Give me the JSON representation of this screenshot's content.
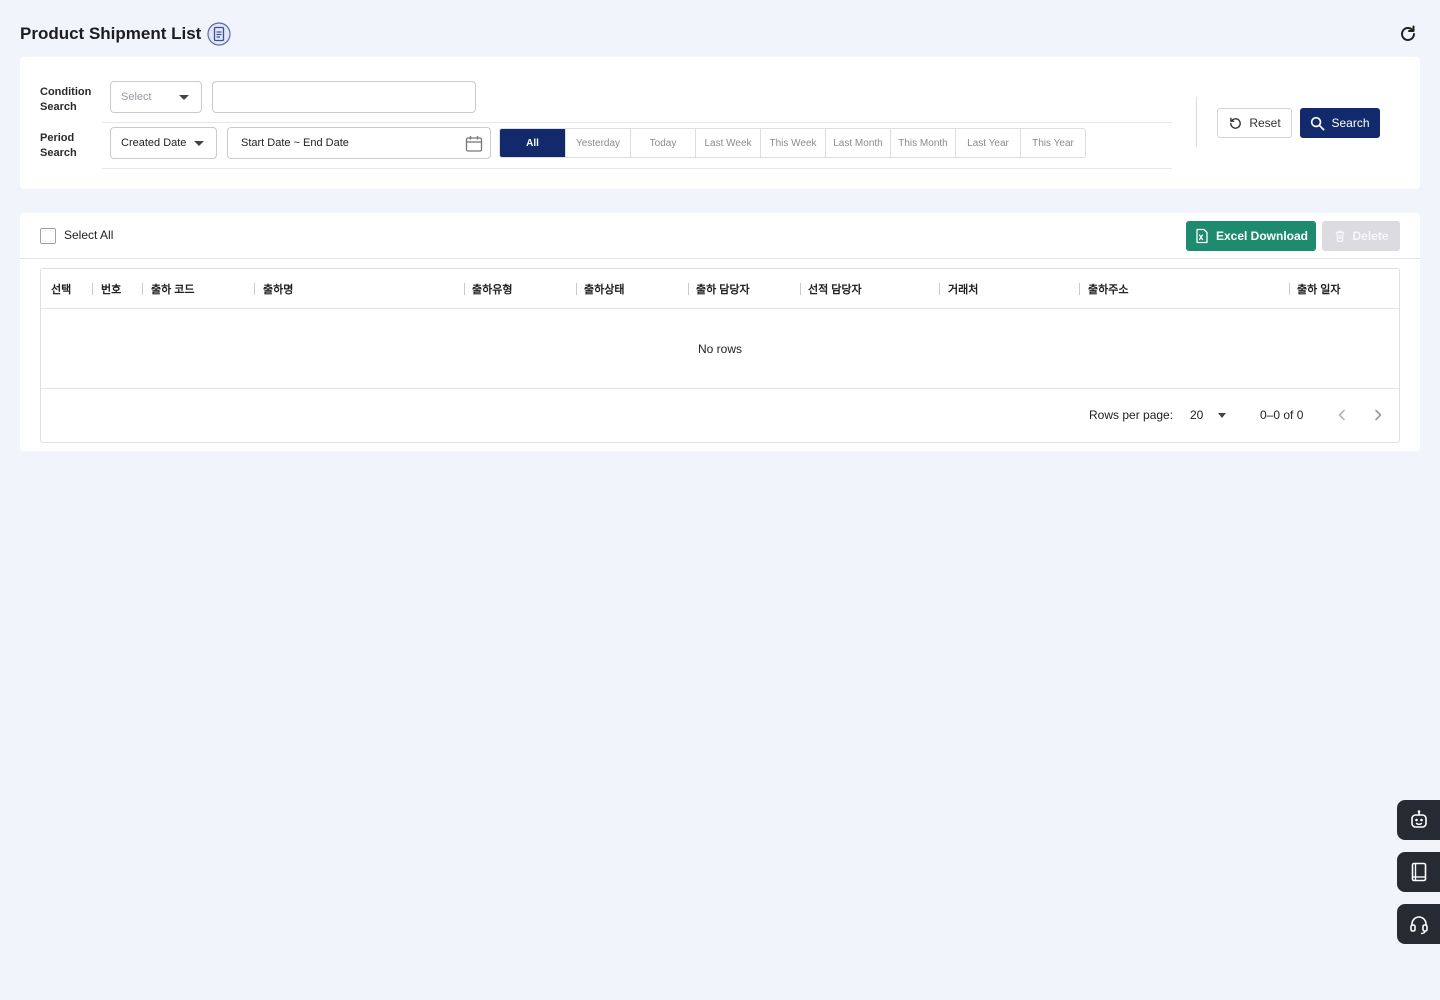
{
  "header": {
    "title": "Product Shipment List",
    "title_icon": "document-icon",
    "refresh_icon": "refresh-icon"
  },
  "filters": {
    "condition_label": "Condition Search",
    "condition_select_placeholder": "Select",
    "condition_text_value": "",
    "period_label": "Period Search",
    "period_select_value": "Created Date",
    "date_range_placeholder": "Start Date ~ End Date",
    "period_buttons": [
      "All",
      "Yesterday",
      "Today",
      "Last Week",
      "This Week",
      "Last Month",
      "This Month",
      "Last Year",
      "This Year"
    ],
    "active_period": "All",
    "reset_label": "Reset",
    "search_label": "Search"
  },
  "toolbar": {
    "select_all_label": "Select All",
    "excel_label": "Excel Download",
    "delete_label": "Delete"
  },
  "table": {
    "columns": [
      "선택",
      "번호",
      "출하 코드",
      "출하명",
      "출하유형",
      "출하상태",
      "출하 담당자",
      "선적 담당자",
      "거래처",
      "출하주소",
      "출하 일자"
    ],
    "empty_text": "No rows",
    "rows_per_page_label": "Rows per page:",
    "rows_per_page": "20",
    "range_text": "0–0 of 0"
  },
  "floating": [
    "chatbot-icon",
    "manual-book-icon",
    "headset-support-icon"
  ],
  "colors": {
    "primary": "#122a6b",
    "excel": "#1e8a6e",
    "background": "#f1f4fb",
    "float": "#262a33"
  }
}
